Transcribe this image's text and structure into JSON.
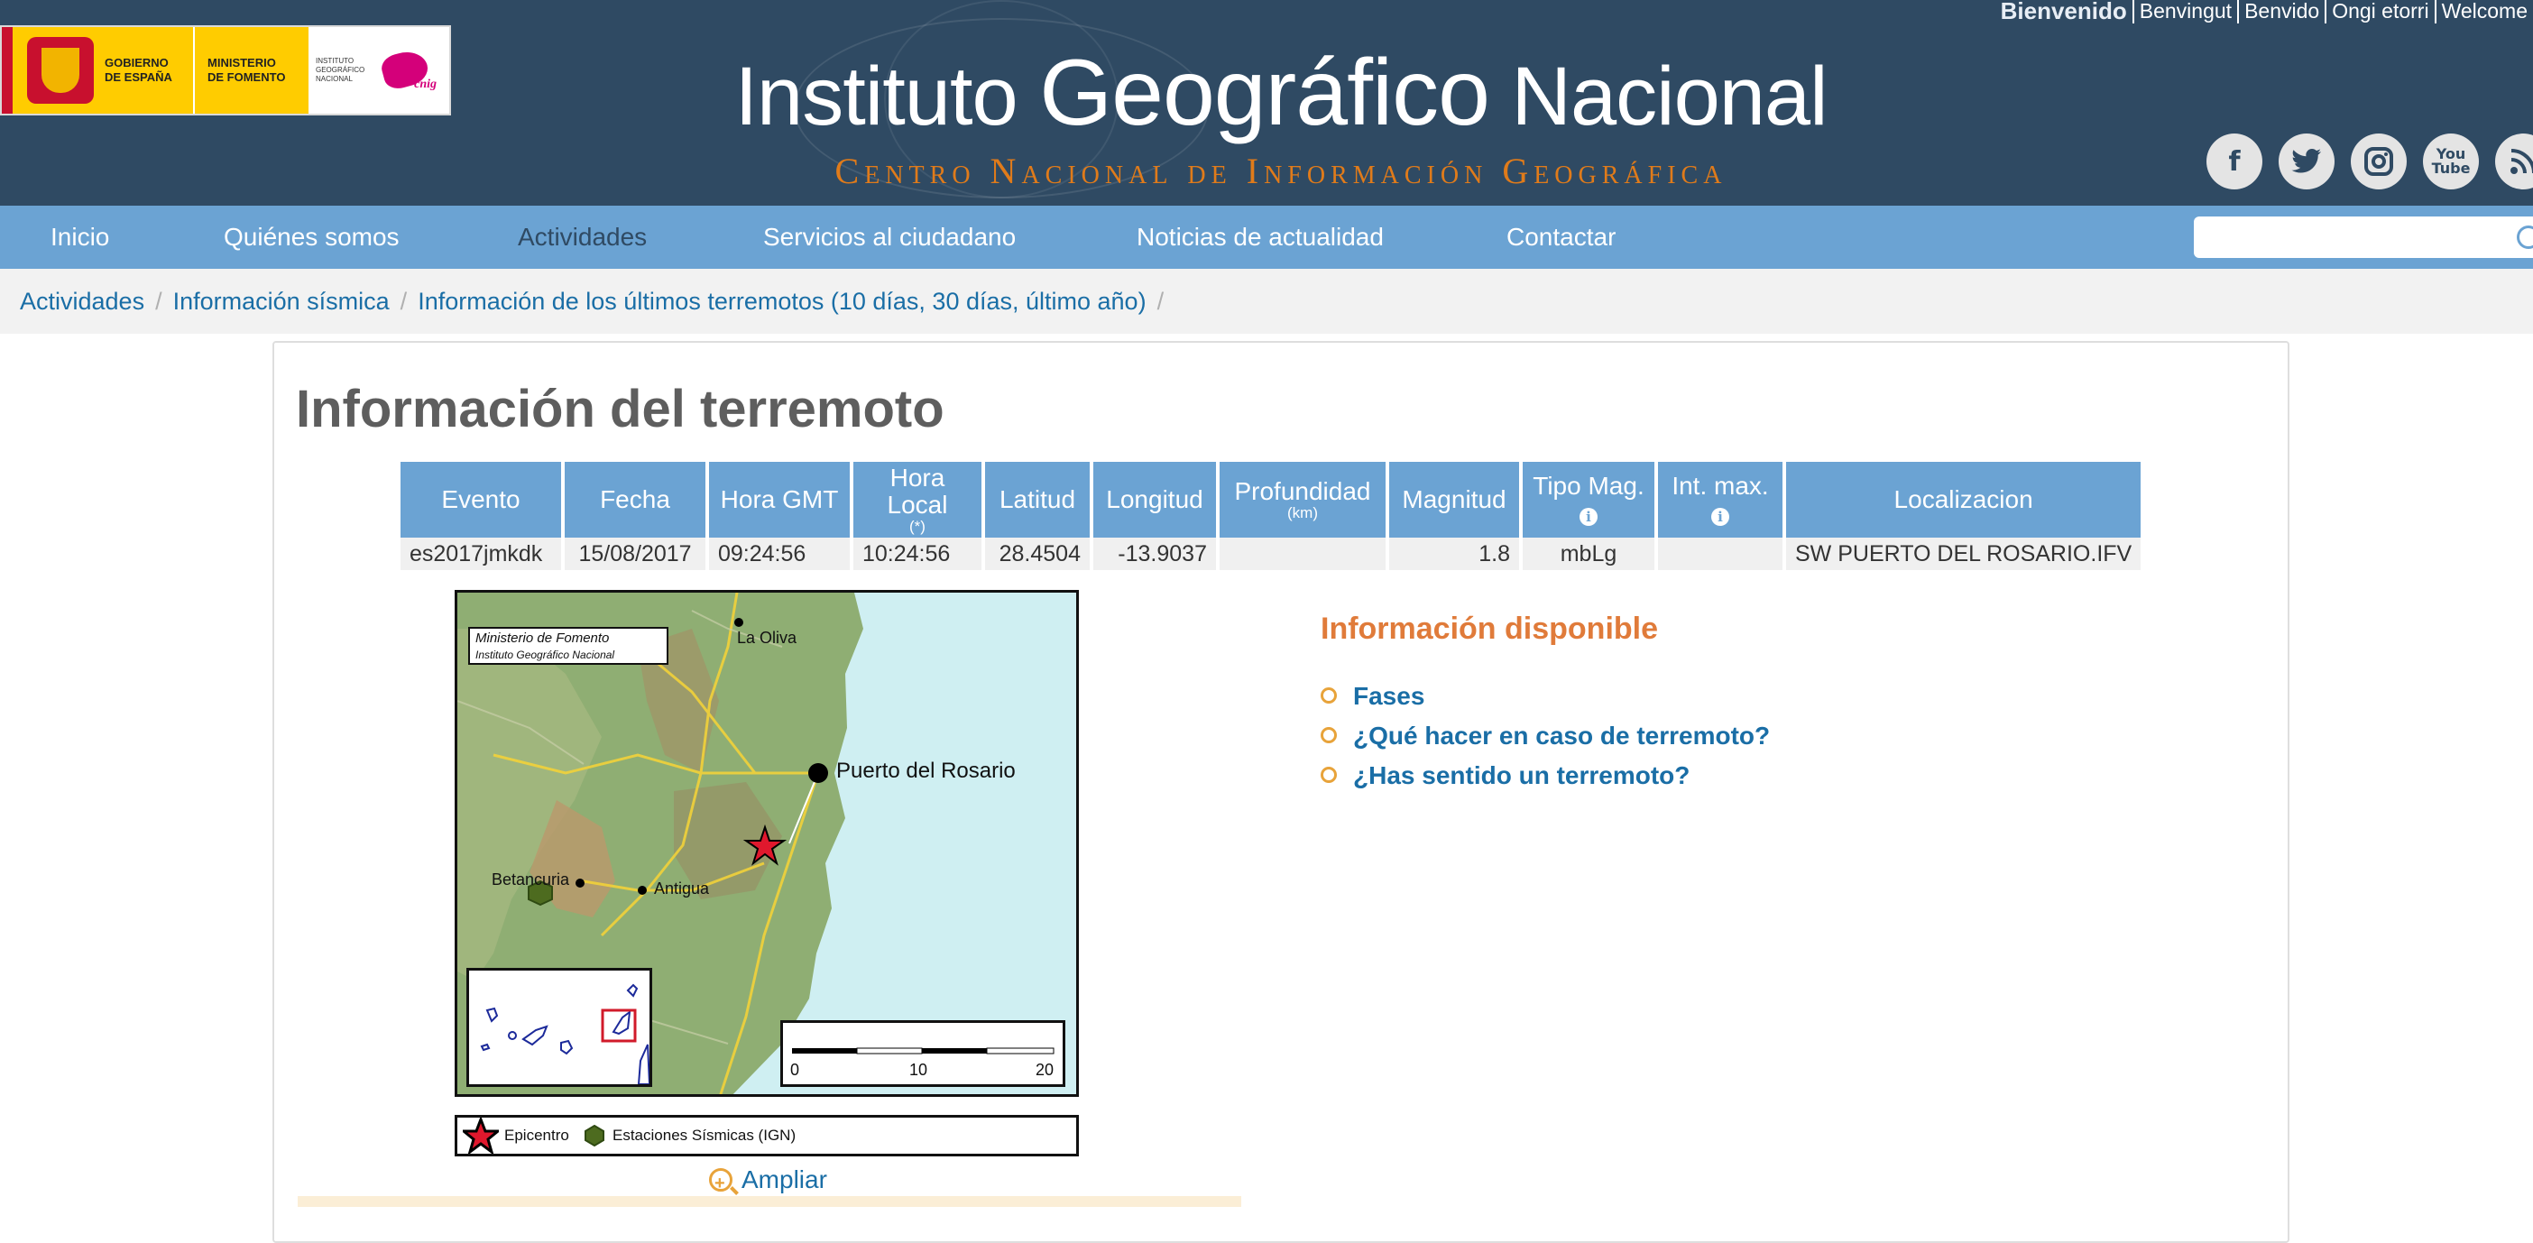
{
  "header": {
    "gov_logo": {
      "line1": "GOBIERNO",
      "line2": "DE ESPAÑA",
      "ministry1": "MINISTERIO",
      "ministry2": "DE FOMENTO",
      "ign_small": "INSTITUTO GEOGRÁFICO NACIONAL",
      "cnig": "cnig"
    },
    "title_part1": "Instituto ",
    "title_part2": "Geográfico",
    "title_part3": " Nacional",
    "subtitle": "Centro Nacional de Información Geográfica",
    "languages": [
      "Bienvenido",
      "Benvingut",
      "Benvido",
      "Ongi etorri",
      "Welcome"
    ],
    "social": [
      "facebook-icon",
      "twitter-icon",
      "instagram-icon",
      "youtube-icon",
      "rss-icon"
    ]
  },
  "nav": {
    "items": [
      "Inicio",
      "Quiénes somos",
      "Actividades",
      "Servicios al ciudadano",
      "Noticias de actualidad",
      "Contactar"
    ],
    "active": "Actividades",
    "search_placeholder": ""
  },
  "breadcrumb": [
    "Actividades",
    "Información sísmica",
    "Información de los últimos terremotos (10 días, 30 días, último año)"
  ],
  "page_title": "Información del terremoto",
  "table": {
    "headers": {
      "evento": "Evento",
      "fecha": "Fecha",
      "hora_gmt": "Hora GMT",
      "hora_local": "Hora Local",
      "hora_local_note": "(*)",
      "latitud": "Latitud",
      "longitud": "Longitud",
      "profundidad": "Profundidad",
      "profundidad_unit": "(km)",
      "magnitud": "Magnitud",
      "tipo_mag": "Tipo Mag.",
      "int_max": "Int. max.",
      "localizacion": "Localizacion"
    },
    "row": {
      "evento": "es2017jmkdk",
      "fecha": "15/08/2017",
      "hora_gmt": "09:24:56",
      "hora_local": "10:24:56",
      "latitud": "28.4504",
      "longitud": "-13.9037",
      "profundidad": "",
      "magnitud": "1.8",
      "tipo_mag": "mbLg",
      "int_max": "",
      "localizacion": "SW PUERTO DEL ROSARIO.IFV"
    }
  },
  "map": {
    "credit_line1": "Ministerio de Fomento",
    "credit_line2": "Instituto Geográfico Nacional",
    "places": {
      "la_oliva": "La Oliva",
      "puerto": "Puerto  del Rosario",
      "betancuria": "Betancuria",
      "antigua": "Antigua"
    },
    "scale_labels": [
      "0",
      "10",
      "20"
    ],
    "colors": {
      "sea": "#cfeff2",
      "land": "#8fae73",
      "roads": "#f2d23a",
      "epicenter": "#e0182d",
      "station": "#4d6b1f"
    }
  },
  "legend": {
    "epicentro": "Epicentro",
    "estaciones": "Estaciones Sísmicas (IGN)"
  },
  "ampliar": "Ampliar",
  "info": {
    "title": "Información disponible",
    "links": [
      "Fases",
      "¿Qué hacer en caso de terremoto?",
      "¿Has sentido un terremoto?"
    ]
  },
  "colors": {
    "header_bg": "#2f4a63",
    "nav_bg": "#6ba3d3",
    "link": "#1a6ea6",
    "accent_orange": "#e07b3a"
  }
}
